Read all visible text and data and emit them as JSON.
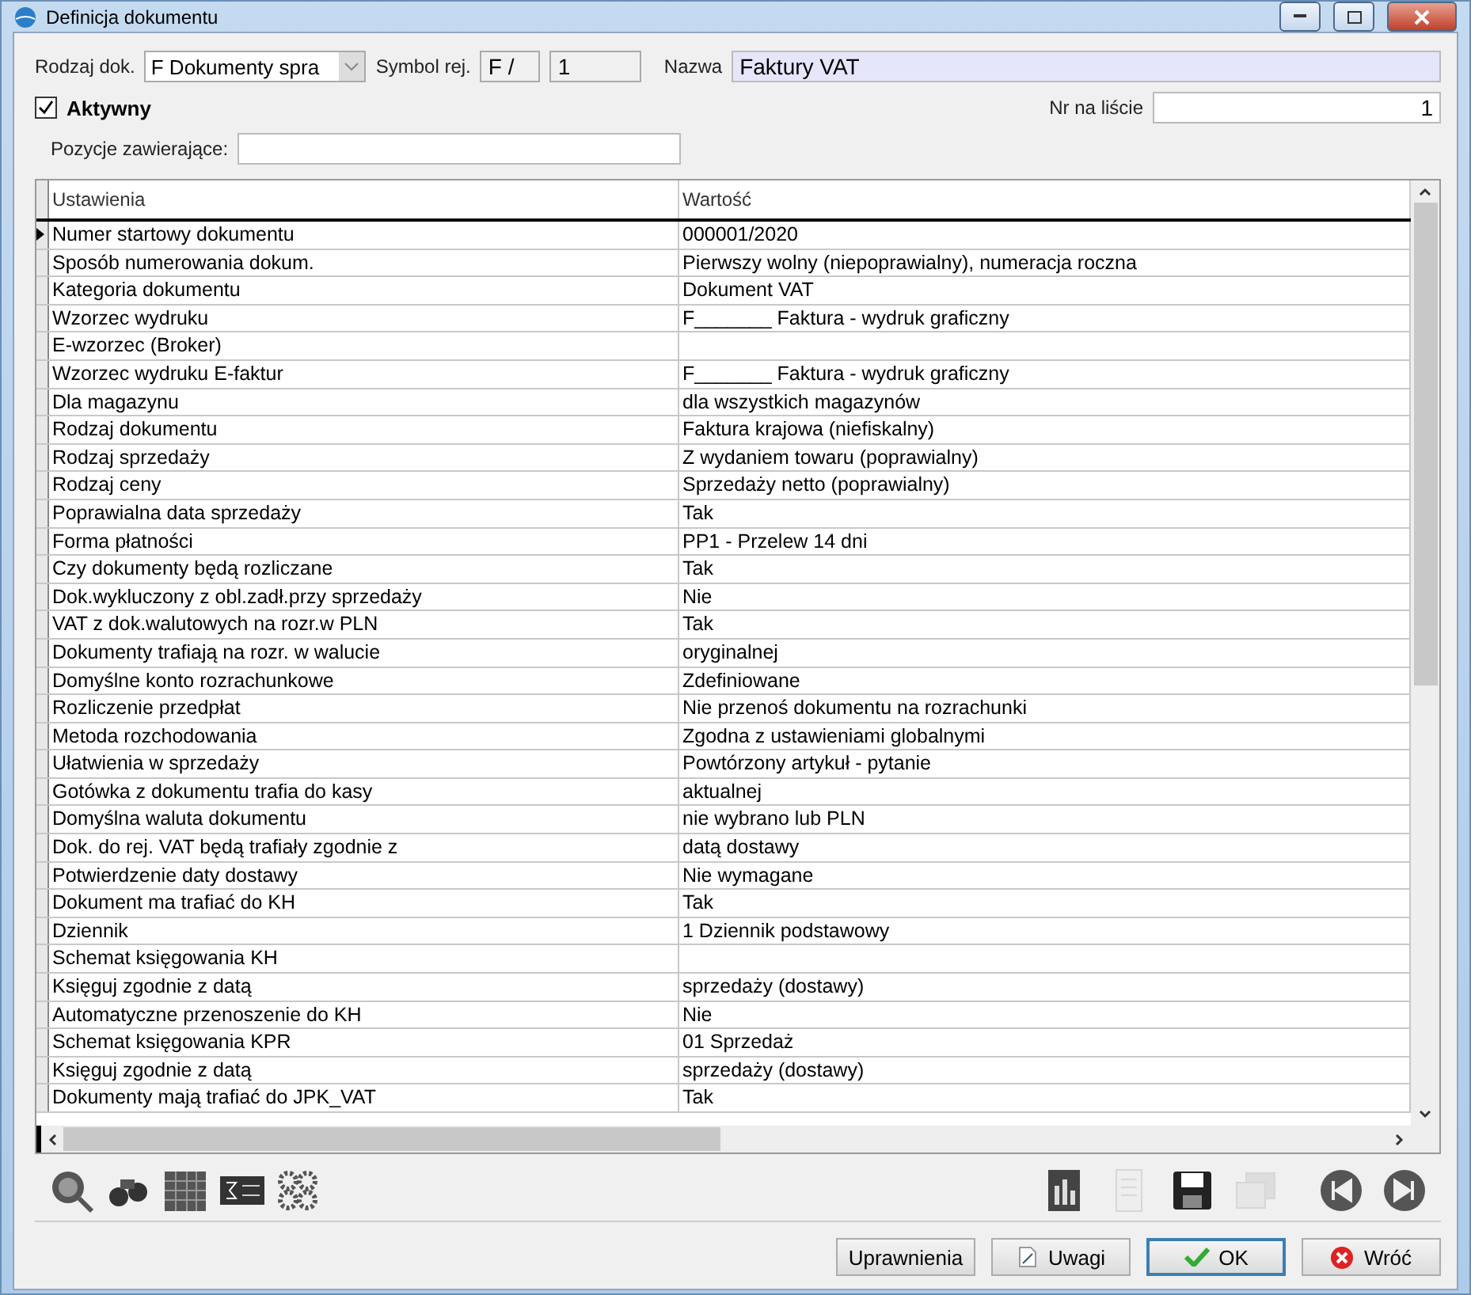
{
  "window": {
    "title": "Definicja dokumentu"
  },
  "header": {
    "rodzaj_label": "Rodzaj dok.",
    "rodzaj_value": "F Dokumenty spra",
    "symbol_label": "Symbol rej.",
    "symbol_prefix": "F /",
    "symbol_number": "1",
    "nazwa_label": "Nazwa",
    "nazwa_value": "Faktury VAT",
    "aktywny": {
      "label": "Aktywny",
      "checked": true
    },
    "nr_label": "Nr na liście",
    "nr_value": "1",
    "pozycje_label": "Pozycje zawierające:"
  },
  "grid": {
    "columns": [
      "Ustawienia",
      "Wartość"
    ],
    "rows": [
      {
        "name": "Numer startowy dokumentu",
        "value": "000001/2020",
        "selected": true
      },
      {
        "name": "Sposób numerowania dokum.",
        "value": "Pierwszy wolny  (niepoprawialny), numeracja roczna",
        "selected": false
      },
      {
        "name": "Kategoria dokumentu",
        "value": "Dokument VAT",
        "selected": false
      },
      {
        "name": "Wzorzec wydruku",
        "value": "F_______ Faktura - wydruk graficzny",
        "selected": false
      },
      {
        "name": "E-wzorzec (Broker)",
        "value": "",
        "selected": false
      },
      {
        "name": "Wzorzec wydruku E-faktur",
        "value": "F_______ Faktura - wydruk graficzny",
        "selected": false
      },
      {
        "name": "Dla magazynu",
        "value": "dla wszystkich magazynów",
        "selected": false
      },
      {
        "name": "Rodzaj dokumentu",
        "value": "Faktura krajowa (niefiskalny)",
        "selected": false
      },
      {
        "name": "Rodzaj sprzedaży",
        "value": "Z wydaniem towaru  (poprawialny)",
        "selected": false
      },
      {
        "name": "Rodzaj ceny",
        "value": "Sprzedaży netto  (poprawialny)",
        "selected": false
      },
      {
        "name": "Poprawialna data sprzedaży",
        "value": "Tak",
        "selected": false
      },
      {
        "name": "Forma płatności",
        "value": "PP1 - Przelew 14 dni",
        "selected": false
      },
      {
        "name": "Czy dokumenty będą rozliczane",
        "value": "Tak",
        "selected": false
      },
      {
        "name": "Dok.wykluczony z obl.zadł.przy sprzedaży",
        "value": "Nie",
        "selected": false
      },
      {
        "name": "VAT z dok.walutowych na rozr.w PLN",
        "value": "Tak",
        "selected": false
      },
      {
        "name": "Dokumenty trafiają na rozr. w walucie",
        "value": "oryginalnej",
        "selected": false
      },
      {
        "name": "Domyślne konto rozrachunkowe",
        "value": "Zdefiniowane",
        "selected": false
      },
      {
        "name": "Rozliczenie przedpłat",
        "value": "Nie przenoś dokumentu na rozrachunki",
        "selected": false
      },
      {
        "name": "Metoda rozchodowania",
        "value": "Zgodna z ustawieniami globalnymi",
        "selected": false
      },
      {
        "name": "Ułatwienia w sprzedaży",
        "value": "Powtórzony artykuł - pytanie",
        "selected": false
      },
      {
        "name": "Gotówka z dokumentu trafia do kasy",
        "value": "aktualnej",
        "selected": false
      },
      {
        "name": "Domyślna waluta dokumentu",
        "value": "nie wybrano lub PLN",
        "selected": false
      },
      {
        "name": "Dok. do rej. VAT będą trafiały zgodnie z",
        "value": "datą dostawy",
        "selected": false
      },
      {
        "name": "Potwierdzenie daty dostawy",
        "value": "Nie wymagane",
        "selected": false
      },
      {
        "name": "Dokument ma trafiać do KH",
        "value": "Tak",
        "selected": false
      },
      {
        "name": "Dziennik",
        "value": "1  Dziennik podstawowy",
        "selected": false
      },
      {
        "name": "Schemat księgowania KH",
        "value": "",
        "selected": false
      },
      {
        "name": "Księguj zgodnie z datą",
        "value": "sprzedaży (dostawy)",
        "selected": false
      },
      {
        "name": "Automatyczne przenoszenie do KH",
        "value": "Nie",
        "selected": false
      },
      {
        "name": "Schemat księgowania KPR",
        "value": "01  Sprzedaż",
        "selected": false
      },
      {
        "name": "Księguj zgodnie z datą",
        "value": "sprzedaży (dostawy)",
        "selected": false
      },
      {
        "name": "Dokumenty mają trafiać do JPK_VAT",
        "value": "Tak",
        "selected": false
      }
    ]
  },
  "toolbar_left": [
    {
      "kind": "find",
      "disabled": false
    },
    {
      "kind": "binoculars",
      "disabled": false
    },
    {
      "kind": "table",
      "disabled": false
    },
    {
      "kind": "sigma",
      "disabled": false
    },
    {
      "kind": "gears",
      "disabled": false
    }
  ],
  "toolbar_right": [
    {
      "kind": "chart",
      "disabled": false
    },
    {
      "kind": "sheet",
      "disabled": true
    },
    {
      "kind": "save",
      "disabled": false
    },
    {
      "kind": "windows",
      "disabled": true
    },
    {
      "kind": "first",
      "disabled": false
    },
    {
      "kind": "last",
      "disabled": false
    }
  ],
  "buttons": [
    {
      "kind": "plain",
      "label": "Uprawnienia"
    },
    {
      "kind": "note",
      "label": "Uwagi"
    },
    {
      "kind": "ok",
      "label": "OK"
    },
    {
      "kind": "cancel",
      "label": "Wróć"
    }
  ]
}
